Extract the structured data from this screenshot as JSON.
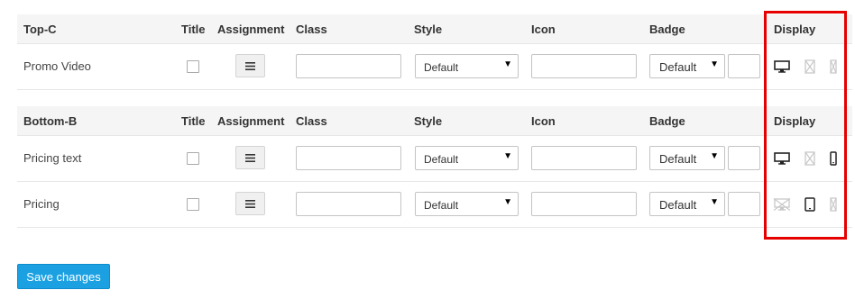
{
  "columns": {
    "title": "Title",
    "assignment": "Assignment",
    "class": "Class",
    "style": "Style",
    "icon": "Icon",
    "badge": "Badge",
    "display": "Display"
  },
  "sections": [
    {
      "name": "Top-C",
      "rows": [
        {
          "label": "Promo Video",
          "style_value": "Default",
          "badge_value": "Default",
          "display": {
            "desktop": "enabled",
            "tablet": "disabled",
            "phone": "disabled"
          }
        }
      ]
    },
    {
      "name": "Bottom-B",
      "rows": [
        {
          "label": "Pricing text",
          "style_value": "Default",
          "badge_value": "Default",
          "display": {
            "desktop": "enabled",
            "tablet": "disabled",
            "phone": "enabled"
          }
        },
        {
          "label": "Pricing",
          "style_value": "Default",
          "badge_value": "Default",
          "display": {
            "desktop": "disabled",
            "tablet": "enabled",
            "phone": "disabled"
          }
        }
      ]
    }
  ],
  "save_label": "Save changes",
  "colors": {
    "accent": "#1ba1e2",
    "highlight": "#e60000",
    "header_bg": "#f5f5f5"
  }
}
